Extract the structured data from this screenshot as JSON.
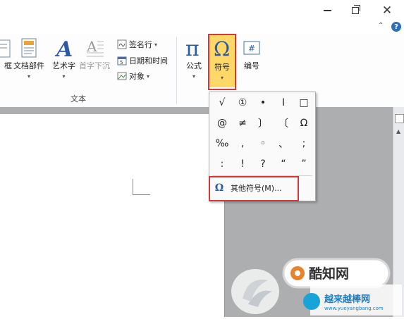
{
  "ribbon": {
    "cut_left_label": "框",
    "doc_parts": "文档部件",
    "wordart": "艺术字",
    "drop_cap": "首字下沉",
    "signature_line": "签名行",
    "date_time": "日期和时间",
    "object": "对象",
    "group_text": "文本",
    "formula": "公式",
    "symbol": "符号",
    "number": "编号"
  },
  "symbol_menu": {
    "rows": [
      [
        "√",
        "①",
        "•",
        "I",
        "□"
      ],
      [
        "@",
        "≠",
        "〕",
        "〔",
        "Ω"
      ],
      [
        "‰",
        ",",
        "◦",
        "、",
        ";"
      ],
      [
        ":",
        "!",
        "?",
        "“",
        "”"
      ]
    ],
    "more_symbols": "其他符号(M)..."
  },
  "watermark": {
    "brand": "酷知网",
    "site_name": "越来越棒网",
    "site_url": "www.yueyangbang.com"
  },
  "colors": {
    "highlight": "#d23a3a",
    "symbol_bg": "#ffd867",
    "help_blue": "#2c6fb7"
  }
}
